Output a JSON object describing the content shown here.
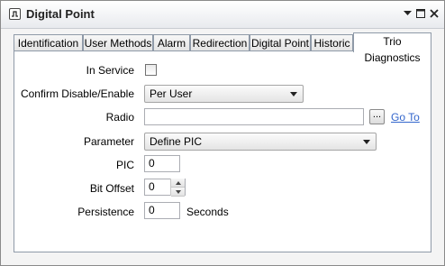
{
  "window": {
    "title": "Digital Point",
    "title_icon": "digital-pulse-icon",
    "menu_icon": "chevron-down-icon",
    "maximize_icon": "maximize-icon",
    "close_icon": "close-icon"
  },
  "tabs": [
    {
      "label": "Identification",
      "active": false
    },
    {
      "label": "User Methods",
      "active": false
    },
    {
      "label": "Alarm",
      "active": false
    },
    {
      "label": "Redirection",
      "active": false
    },
    {
      "label": "Digital Point",
      "active": false
    },
    {
      "label": "Historic",
      "active": false
    },
    {
      "label": "Trio Diagnostics",
      "active": true
    }
  ],
  "form": {
    "in_service": {
      "label": "In Service",
      "checked": false
    },
    "confirm_disable": {
      "label": "Confirm Disable/Enable",
      "value": "Per User"
    },
    "radio": {
      "label": "Radio",
      "value": "",
      "browse_label": "...",
      "goto_label": "Go To"
    },
    "parameter": {
      "label": "Parameter",
      "value": "Define PIC"
    },
    "pic": {
      "label": "PIC",
      "value": "0"
    },
    "bit_offset": {
      "label": "Bit Offset",
      "value": "0"
    },
    "persistence": {
      "label": "Persistence",
      "value": "0",
      "unit": "Seconds"
    }
  },
  "colors": {
    "link": "#3366cc",
    "panel_border": "#8f9aa8"
  }
}
